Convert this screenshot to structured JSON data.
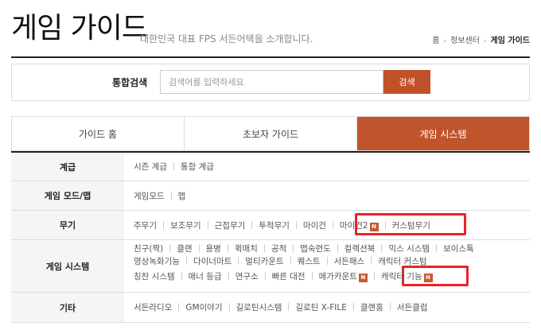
{
  "header": {
    "title": "게임 가이드",
    "subtitle": "대한민국 대표 FPS 서든어택을 소개합니다.",
    "breadcrumb": [
      "홈",
      "정보센터",
      "게임 가이드"
    ]
  },
  "search": {
    "label": "통합검색",
    "placeholder": "검색어를 입력하세요",
    "button": "검색"
  },
  "tabs": [
    {
      "label": "가이드 홈",
      "active": false
    },
    {
      "label": "초보자 가이드",
      "active": false
    },
    {
      "label": "게임 시스템",
      "active": true
    }
  ],
  "rows": {
    "level": {
      "label": "계급",
      "items": [
        "시즌 계급",
        "통합 계급"
      ]
    },
    "mode": {
      "label": "게임 모드/맵",
      "items": [
        "게임모드",
        "맵"
      ]
    },
    "weapon": {
      "label": "무기",
      "items": [
        "주무기",
        "보조무기",
        "근접무기",
        "투척무기",
        "마이건",
        "마이건2",
        "커스텀무기"
      ]
    },
    "system": {
      "label": "게임 시스템",
      "line1": [
        "친구(짝)",
        "클랜",
        "용병",
        "퀵매치",
        "공적",
        "맵숙련도",
        "컬렉션북",
        "믹스 시스템",
        "보이스톡"
      ],
      "line2": [
        "영상녹화기능",
        "다이너마트",
        "멀티카운트",
        "퀘스트",
        "서든패스",
        "캐릭터 커스텀"
      ],
      "line3": [
        "칭찬 시스템",
        "매너 등급",
        "연구소",
        "빠른 대전",
        "메가카운트",
        "캐릭터 기능"
      ]
    },
    "etc": {
      "label": "기타",
      "items": [
        "서든라디오",
        "GM이야기",
        "길로틴시스템",
        "길로틴 X-FILE",
        "클랜홈",
        "서든클럽"
      ]
    }
  },
  "badge_text": "N",
  "colors": {
    "accent": "#c0522a",
    "highlight_box": "#e8232a"
  }
}
